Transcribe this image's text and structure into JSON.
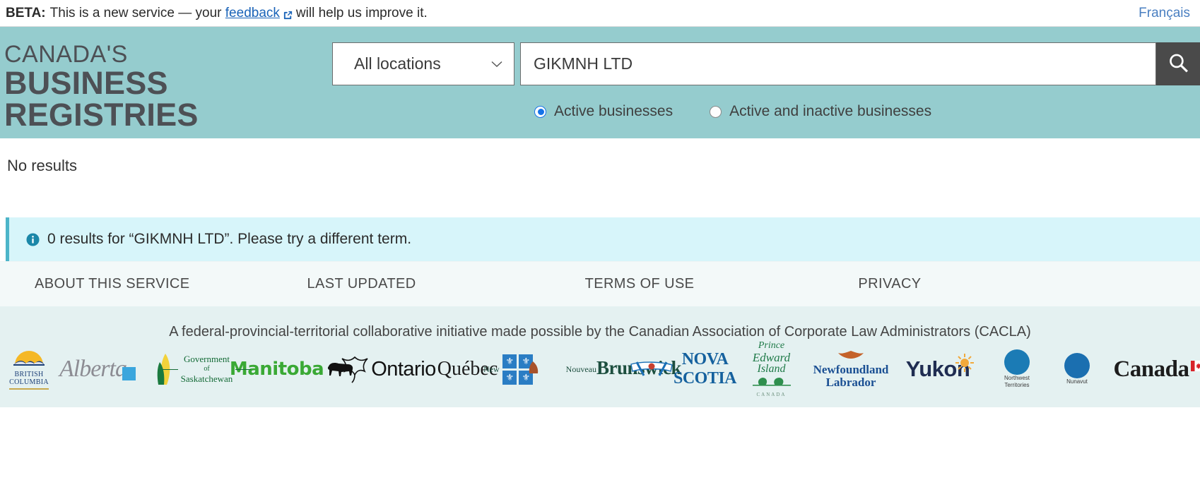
{
  "beta": {
    "label": "BETA:",
    "text_before": "This is a new service — your",
    "link": "feedback",
    "text_after": "will help us improve it.",
    "external_icon": "external-link-icon",
    "language_link": "Français"
  },
  "header": {
    "brand_line1": "CANADA'S",
    "brand_line2": "BUSINESS REGISTRIES",
    "background_color": "#95ccce",
    "location_select": {
      "value": "All locations",
      "chevron": "chevron-down-icon"
    },
    "search": {
      "value": "GIKMNH LTD",
      "placeholder": "",
      "button_icon": "search-icon",
      "button_color": "#4a4a4a"
    },
    "filters": [
      {
        "label": "Active businesses",
        "checked": true
      },
      {
        "label": "Active and inactive businesses",
        "checked": false
      }
    ],
    "radio_accent_color": "#1673e8"
  },
  "main": {
    "no_results_heading": "No results",
    "info_banner": {
      "icon": "info-icon",
      "message": "0 results for “GIKMNH LTD”. Please try a different term.",
      "background_color": "#d7f5fa",
      "accent_color": "#4db5c9"
    }
  },
  "footer": {
    "links": [
      "ABOUT THIS SERVICE",
      "LAST UPDATED",
      "TERMS OF USE",
      "PRIVACY"
    ],
    "tagline": "A federal-provincial-territorial collaborative initiative made possible by the Canadian Association of Corporate Law Administrators (CACLA)",
    "logos": [
      {
        "name": "british-columbia",
        "label_line1": "BRITISH",
        "label_line2": "COLUMBIA"
      },
      {
        "name": "alberta",
        "label": "Alberta"
      },
      {
        "name": "saskatchewan",
        "label_line1": "Government",
        "label_line2": "of",
        "label_line3": "Saskatchewan"
      },
      {
        "name": "manitoba",
        "label": "Manitoba"
      },
      {
        "name": "ontario",
        "label": "Ontario"
      },
      {
        "name": "quebec",
        "label": "Québec"
      },
      {
        "name": "new-brunswick",
        "label_en": "New",
        "label_fr": "Nouveau",
        "label_main": "Brunswick"
      },
      {
        "name": "nova-scotia",
        "label": "NOVA SCOTIA"
      },
      {
        "name": "prince-edward-island",
        "label_line1": "Prince",
        "label_line2": "Edward",
        "label_line3": "Island",
        "label_sub": "CANADA"
      },
      {
        "name": "newfoundland-labrador",
        "label_line1": "Newfoundland",
        "label_line2": "Labrador"
      },
      {
        "name": "yukon",
        "label": "Yukon"
      },
      {
        "name": "northwest-territories",
        "label_line1": "Northwest",
        "label_line2": "Territories"
      },
      {
        "name": "nunavut",
        "label": "Nunavut"
      },
      {
        "name": "canada-wordmark",
        "label": "Canada"
      }
    ]
  }
}
